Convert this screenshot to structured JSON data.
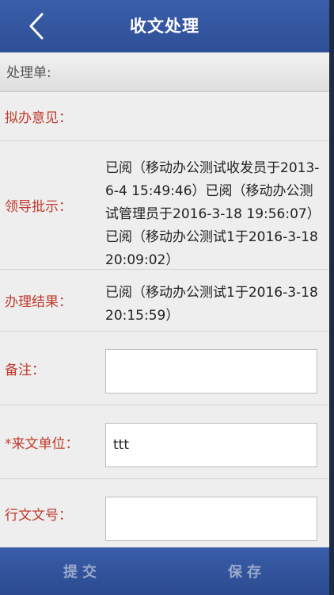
{
  "header": {
    "title": "收文处理"
  },
  "section": {
    "label": "处理单:"
  },
  "rows": {
    "opinion": {
      "label": "拟办意见：",
      "value": ""
    },
    "leader": {
      "label": "领导批示：",
      "value": "已阅（移动办公测试收发员于2013-6-4 15:49:46）已阅（移动办公测试管理员于2016-3-18 19:56:07）已阅（移动办公测试1于2016-3-18 20:09:02）"
    },
    "result": {
      "label": "办理结果：",
      "value": "已阅（移动办公测试1于2016-3-18 20:15:59）"
    },
    "remark": {
      "label": "备注：",
      "value": ""
    },
    "unit": {
      "label": "*来文单位：",
      "value": "ttt"
    },
    "docno": {
      "label": "行文文号：",
      "value": ""
    }
  },
  "footer": {
    "submit_label": "提交",
    "save_label": "保存"
  },
  "colors": {
    "header": "#2e4f97",
    "label": "#c0392b"
  }
}
